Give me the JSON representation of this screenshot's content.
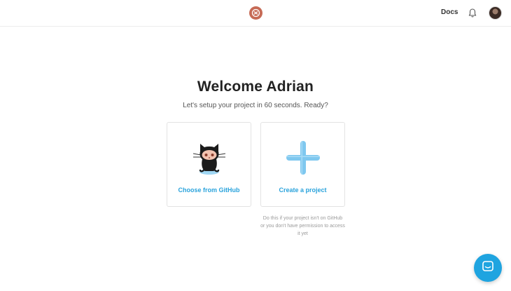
{
  "header": {
    "logo_icon": "app-logo-icon",
    "docs_label": "Docs",
    "notifications_icon": "bell-icon",
    "avatar_icon": "user-avatar"
  },
  "main": {
    "title": "Welcome Adrian",
    "subtitle": "Let's setup your project in 60 seconds. Ready?",
    "cards": [
      {
        "label": "Choose from GitHub",
        "icon": "github-octocat-icon"
      },
      {
        "label": "Create a project",
        "icon": "plus-icon"
      }
    ],
    "helper_note": "Do this if your project isn't on GitHub or you don't have permission to access it yet"
  },
  "chat": {
    "icon": "chat-icon"
  },
  "colors": {
    "accent": "#2aa3dc",
    "chat_bg": "#1fa4e0",
    "logo": "#c66a55"
  }
}
